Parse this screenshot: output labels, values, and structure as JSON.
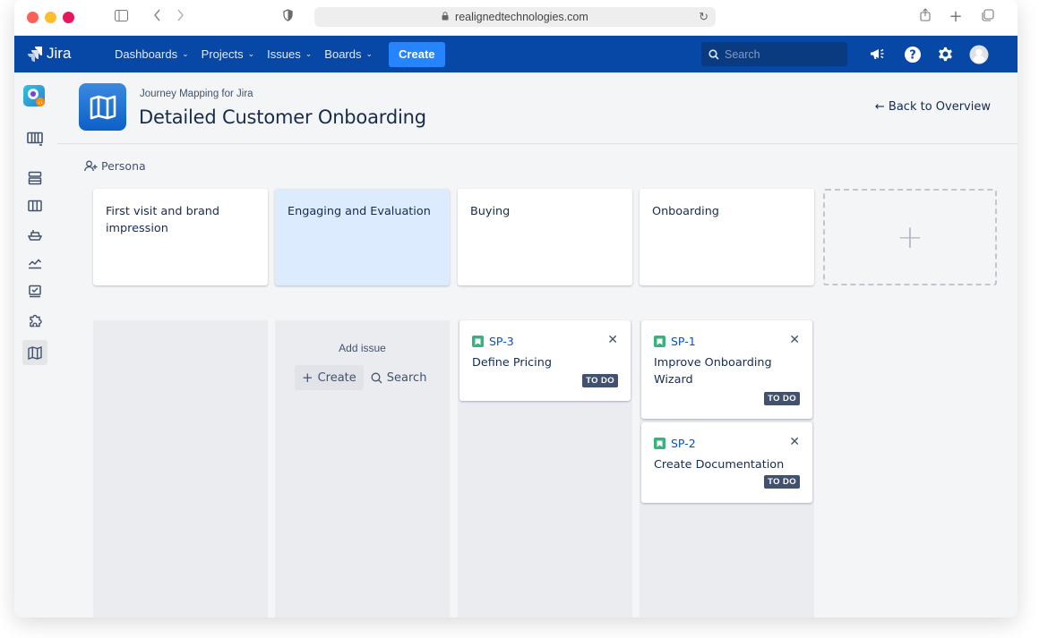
{
  "browser": {
    "url": "realignedtechnologies.com"
  },
  "nav": {
    "logo": "Jira",
    "items": [
      {
        "label": "Dashboards"
      },
      {
        "label": "Projects"
      },
      {
        "label": "Issues"
      },
      {
        "label": "Boards"
      }
    ],
    "create_label": "Create",
    "search_placeholder": "Search"
  },
  "header": {
    "breadcrumb": "Journey Mapping for Jira",
    "title": "Detailed Customer Onboarding",
    "back_label": "← Back to Overview"
  },
  "persona_label": "Persona",
  "stages": [
    {
      "label": "First visit and brand impression",
      "selected": false
    },
    {
      "label": "Engaging and Evaluation",
      "selected": true
    },
    {
      "label": "Buying",
      "selected": false
    },
    {
      "label": "Onboarding",
      "selected": false
    }
  ],
  "lanes": {
    "add_issue_label": "Add issue",
    "create_label": "Create",
    "search_label": "Search"
  },
  "cards": [
    {
      "key": "SP-3",
      "summary": "Define Pricing",
      "status": "TO DO"
    },
    {
      "key": "SP-1",
      "summary": "Improve Onboarding Wizard",
      "status": "TO DO"
    },
    {
      "key": "SP-2",
      "summary": "Create Documentation",
      "status": "TO DO"
    }
  ],
  "colors": {
    "nav_bg": "#0747a6",
    "create_button": "#2684ff",
    "selected_stage": "#dcebfd",
    "story_icon": "#36b37e",
    "status_badge": "#42526e"
  }
}
